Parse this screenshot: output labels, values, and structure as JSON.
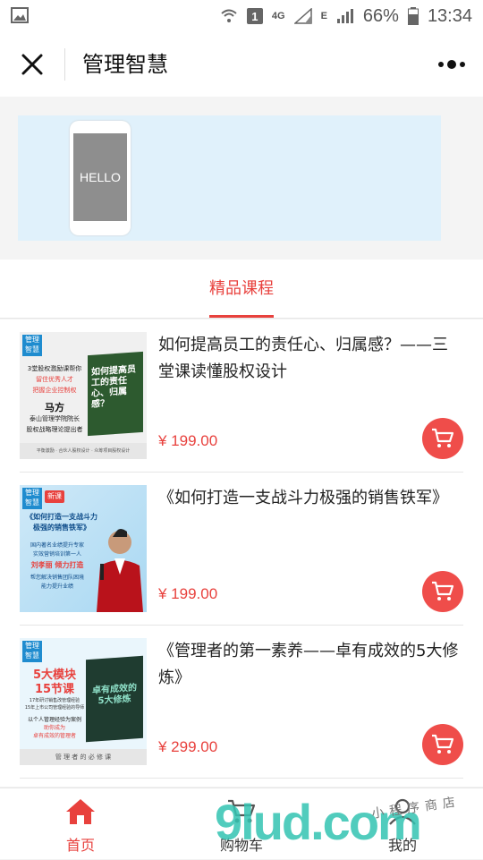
{
  "status_bar": {
    "network": "4G",
    "sim_badge": "1",
    "edge": "E",
    "battery": "66%",
    "time": "13:34"
  },
  "header": {
    "title": "管理智慧"
  },
  "banner": {
    "phone_text": "HELLO"
  },
  "tabs": [
    {
      "label": "精品课程",
      "active": true
    }
  ],
  "courses": [
    {
      "title": "如何提高员工的责任心、归属感？——三堂课读懂股权设计",
      "price": "¥ 199.00",
      "thumb": {
        "badge": "管理智慧",
        "line1": "3堂股权激励课帮你",
        "line2": "留住优秀人才",
        "line3": "把握企业控制权",
        "name": "马方",
        "role1": "泰山管理学院院长",
        "role2": "股权战略理论提出者",
        "book_title": "如何提高员工的责任心、归属感？",
        "footer": "平衡激励 · 合伙人股权设计 · 众筹项目股权设计"
      }
    },
    {
      "title": "《如何打造一支战斗力极强的销售铁军》",
      "price": "¥ 199.00",
      "thumb": {
        "badge": "管理智慧",
        "new": "新课",
        "heading": "《如何打造一支战斗力极强的销售铁军》",
        "line1": "国内著名业绩提升专家",
        "line2": "实效营销培训第一人",
        "name": "刘孝丽 倾力打造",
        "line3": "帮您解决销售团队困境",
        "line4": "能力提升业绩"
      }
    },
    {
      "title": "《管理者的第一素养——卓有成效的5大修炼》",
      "price": "¥ 299.00",
      "thumb": {
        "badge": "管理智慧",
        "big1": "5大模块",
        "big2": "15节课",
        "line1": "17年研讨销售改管理经验",
        "line2": "15年上市公司管理经验的导师",
        "line3": "以个人管理经验为案例",
        "line4": "助你成为",
        "line5": "卓有成效的管理者",
        "book_title": "卓有成效的5大修炼",
        "footer": "管 理 者 的 必 修 课"
      }
    }
  ],
  "bottom_nav": [
    {
      "label": "首页",
      "icon": "home-icon",
      "active": true
    },
    {
      "label": "购物车",
      "icon": "cart-icon",
      "active": false
    },
    {
      "label": "我的",
      "icon": "user-icon",
      "active": false
    }
  ],
  "watermark": {
    "big": "9lud.com",
    "small": "小程序商店"
  },
  "colors": {
    "accent": "#e8413d",
    "banner_bg": "#e0f1fb"
  }
}
